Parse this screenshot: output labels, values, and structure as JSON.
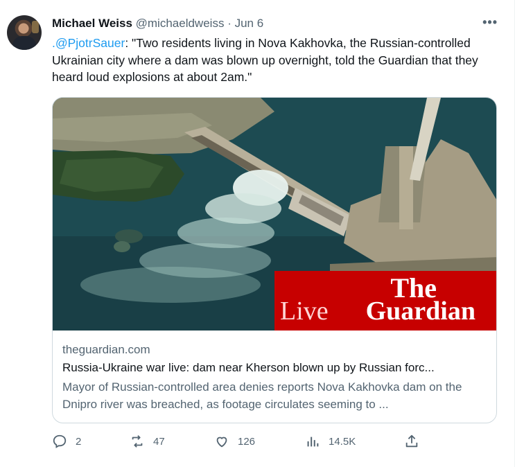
{
  "tweet": {
    "author_name": "Michael Weiss",
    "handle": "@michaeldweiss",
    "separator": "·",
    "date": "Jun 6",
    "more_icon": "more-horizontal-icon",
    "mention": ".@PjotrSauer",
    "body": ": \"Two residents living in Nova Kakhovka, the Russian-controlled Ukrainian city where a dam was blown up overnight, told the Guardian that they heard loud explosions at about 2am.\""
  },
  "card": {
    "brand_line1": "The",
    "brand_live": "Live",
    "brand_line2": "Guardian",
    "domain": "theguardian.com",
    "title": "Russia-Ukraine war live: dam near Kherson blown up by Russian forc...",
    "description": "Mayor of Russian-controlled area denies reports Nova Kakhovka dam on the Dnipro river was breached, as footage circulates seeming to ..."
  },
  "actions": {
    "replies": "2",
    "retweets": "47",
    "likes": "126",
    "views": "14.5K"
  },
  "colors": {
    "accent": "#1d9bf0",
    "guardian_red": "#c70000",
    "muted": "#536471",
    "water": "#1e4a50"
  }
}
